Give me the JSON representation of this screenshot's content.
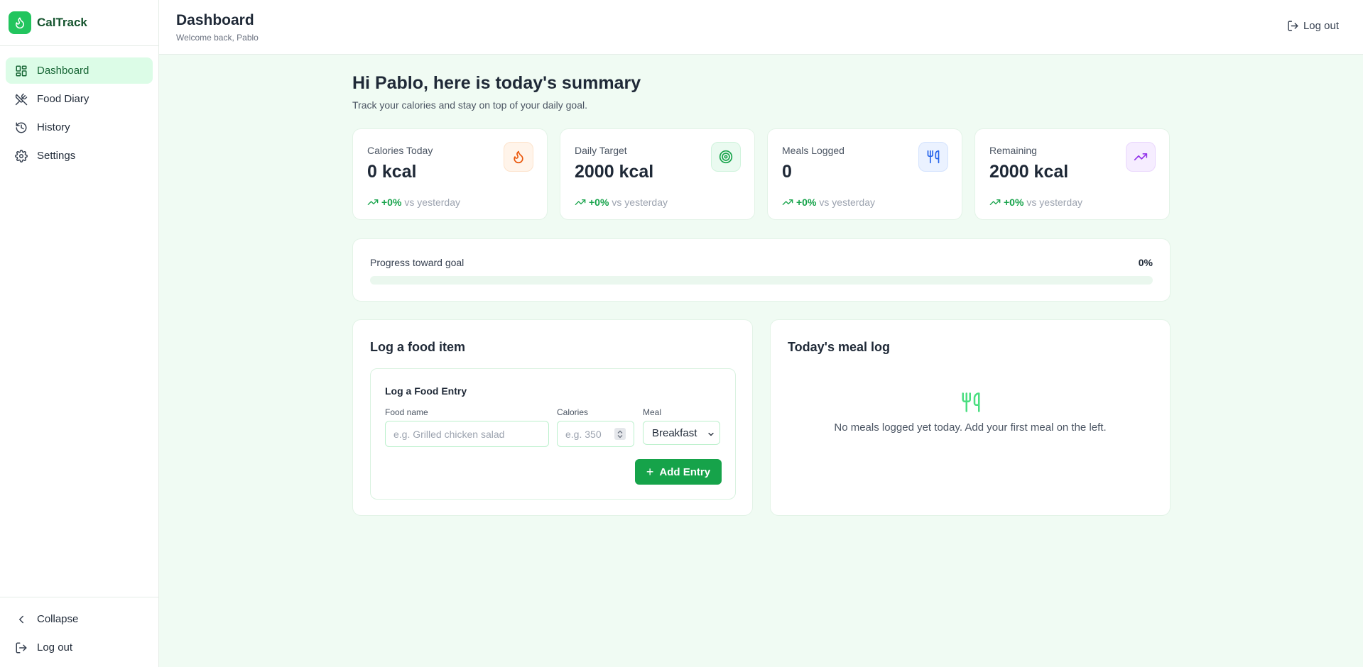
{
  "app": {
    "name": "CalTrack"
  },
  "sidebar": {
    "items": [
      {
        "label": "Dashboard",
        "icon": "dashboard-icon",
        "active": true
      },
      {
        "label": "Food Diary",
        "icon": "utensils-crossed-icon",
        "active": false
      },
      {
        "label": "History",
        "icon": "history-icon",
        "active": false
      },
      {
        "label": "Settings",
        "icon": "gear-icon",
        "active": false
      }
    ],
    "collapse_label": "Collapse",
    "logout_label": "Log out"
  },
  "header": {
    "title": "Dashboard",
    "subtitle": "Welcome back, Pablo",
    "logout_label": "Log out"
  },
  "summary": {
    "greeting": "Hi Pablo, here is today's summary",
    "subtitle": "Track your calories and stay on top of your daily goal."
  },
  "stats": [
    {
      "label": "Calories Today",
      "value": "0 kcal",
      "trend": "+0%",
      "trend_suffix": "vs yesterday",
      "icon": "flame-icon",
      "icon_color": "#ea580c",
      "icon_bg": "#fff4ea"
    },
    {
      "label": "Daily Target",
      "value": "2000 kcal",
      "trend": "+0%",
      "trend_suffix": "vs yesterday",
      "icon": "target-icon",
      "icon_color": "#16a34a",
      "icon_bg": "#eafaf0"
    },
    {
      "label": "Meals Logged",
      "value": "0",
      "trend": "+0%",
      "trend_suffix": "vs yesterday",
      "icon": "utensils-icon",
      "icon_color": "#2563eb",
      "icon_bg": "#ebf2ff"
    },
    {
      "label": "Remaining",
      "value": "2000 kcal",
      "trend": "+0%",
      "trend_suffix": "vs yesterday",
      "icon": "trending-up-icon",
      "icon_color": "#9333ea",
      "icon_bg": "#f6edff"
    }
  ],
  "progress": {
    "label": "Progress toward goal",
    "percent_text": "0%",
    "value": 0
  },
  "log_panel": {
    "title": "Log a food item",
    "form_title": "Log a Food Entry",
    "food_label": "Food name",
    "food_placeholder": "e.g. Grilled chicken salad",
    "calories_label": "Calories",
    "calories_placeholder": "e.g. 350",
    "meal_label": "Meal",
    "meal_selected": "Breakfast",
    "add_label": "Add Entry"
  },
  "meal_log": {
    "title": "Today's meal log",
    "empty_text": "No meals logged yet today. Add your first meal on the left."
  },
  "colors": {
    "brand": "#22c55e",
    "accent": "#16a34a",
    "background": "#f0fbf3"
  }
}
